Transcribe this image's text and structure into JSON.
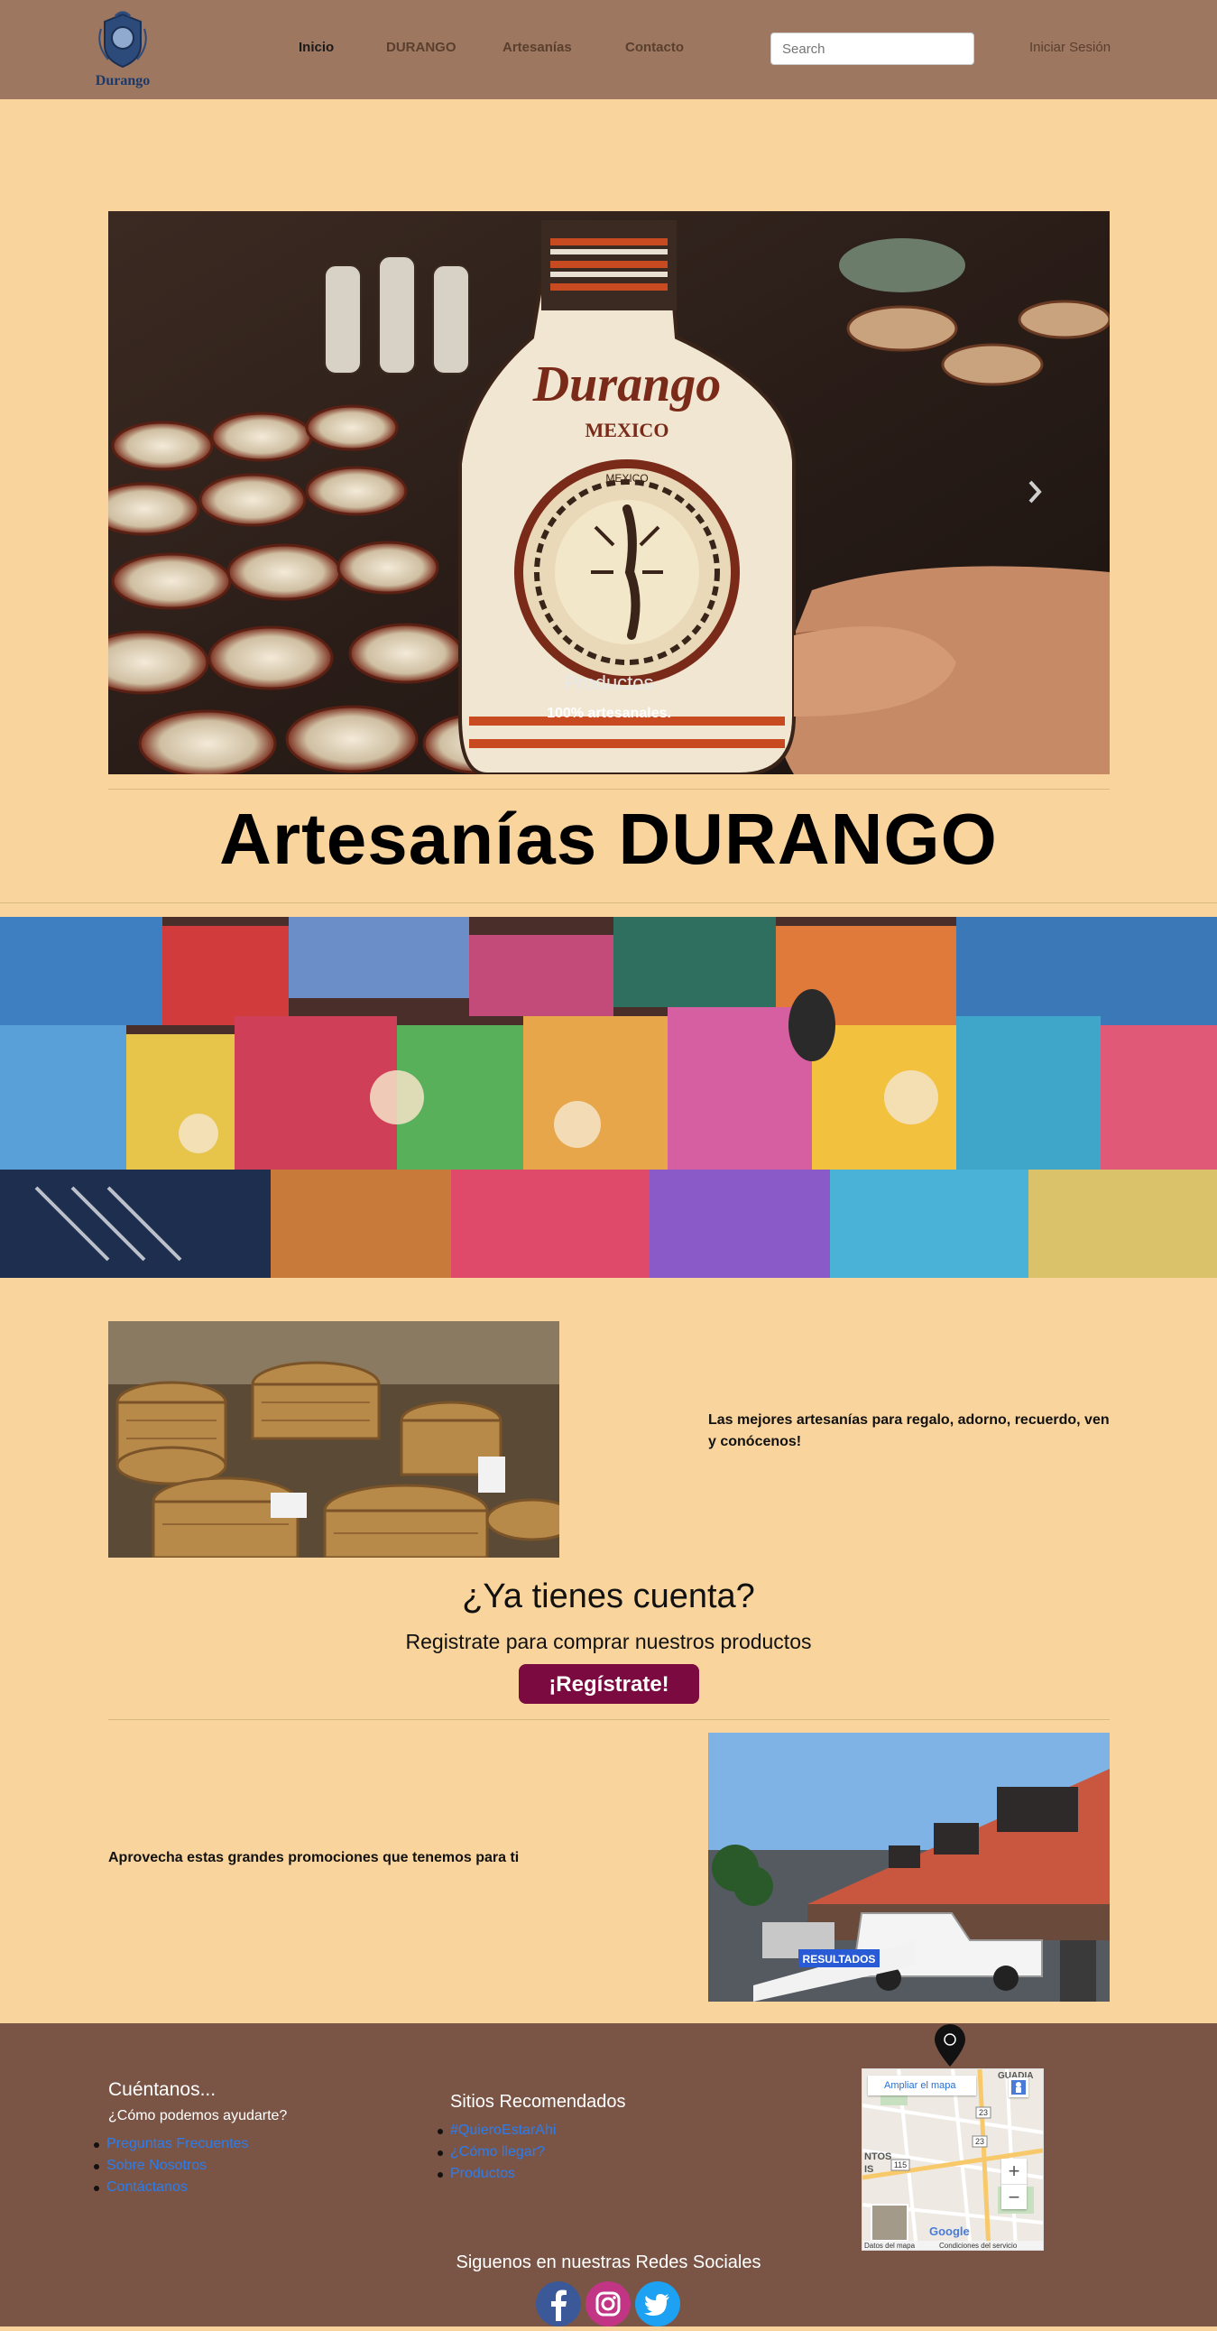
{
  "navbar": {
    "logo_text": "Durango",
    "links": [
      "Inicio",
      "DURANGO",
      "Artesanías",
      "Contacto"
    ],
    "search_placeholder": "Search",
    "login": "Iniciar Sesión"
  },
  "carousel": {
    "caption_title": "Productos",
    "caption_sub": "100% artesanales.",
    "bottle_text": "Durango",
    "bottle_sub": "MEXICO",
    "bottle_medallion": "MEXICO"
  },
  "main_title": "Artesanías DURANGO",
  "promo1": "Las mejores artesanías para regalo, adorno, recuerdo, ven y conócenos!",
  "account": {
    "title": "¿Ya tienes cuenta?",
    "subtitle": "Registrate para comprar nuestros productos",
    "button": "¡Regístrate!"
  },
  "promo2": "Aprovecha estas grandes promociones que tenemos para ti",
  "street_sign": "RESULTADOS",
  "footer": {
    "col1_title": "Cuéntanos...",
    "col1_sub": "¿Cómo podemos ayudarte?",
    "col1_links": [
      "Preguntas Frecuentes",
      "Sobre Nosotros",
      "Contáctanos"
    ],
    "col2_title": "Sitios Recomendados",
    "col2_links": [
      "#QuieroEstarAhi",
      "¿Cómo llegar?",
      "Productos"
    ],
    "map": {
      "enlarge": "Ampliar el mapa",
      "label_top": "GUADIA",
      "label_left": "NTOS",
      "label_left2": "IS",
      "route1": "23",
      "route2": "115",
      "route3": "23",
      "google": "Google",
      "data": "Datos del mapa",
      "terms": "Condiciones del servicio",
      "zoom_in": "+",
      "zoom_out": "−"
    },
    "social_title": "Siguenos en nuestras Redes Sociales"
  },
  "colors": {
    "page_bg": "#f9d49c",
    "navbar_bg": "#9d7760",
    "footer_bg": "#7a5546",
    "button_bg": "#7b0a40",
    "link": "#2a7df0"
  },
  "icons": [
    "crest-logo-icon",
    "chevron-right-icon",
    "map-pin-icon",
    "facebook-icon",
    "instagram-icon",
    "twitter-icon"
  ]
}
